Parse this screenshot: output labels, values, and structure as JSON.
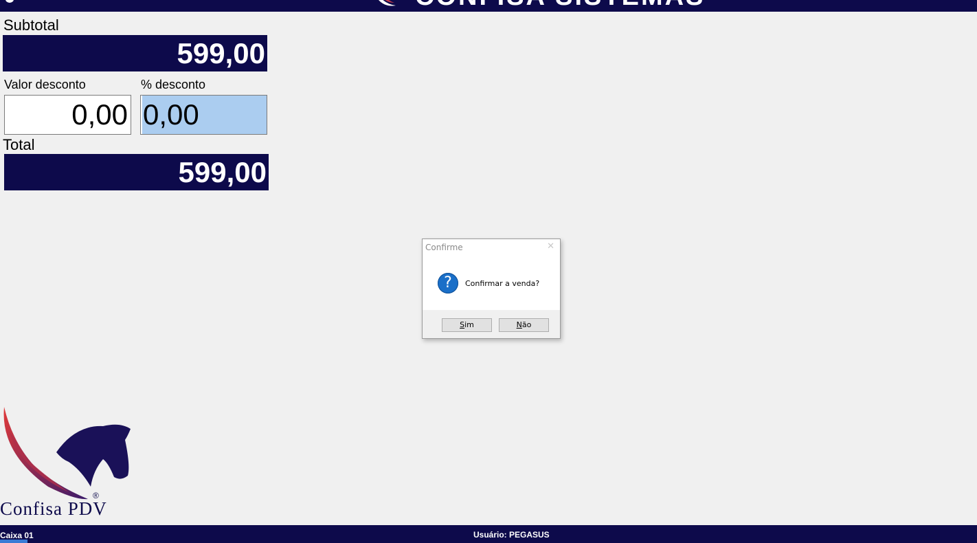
{
  "banner": {
    "text": "CONFISA SISTEMAS"
  },
  "summary": {
    "subtotal_label": "Subtotal",
    "subtotal_value": "599,00",
    "discount_value_label": "Valor desconto",
    "discount_value": "0,00",
    "discount_percent_label": "% desconto",
    "discount_percent": "0,00",
    "total_label": "Total",
    "total_value": "599,00"
  },
  "logo": {
    "text": "Confisa PDV",
    "registered": "®"
  },
  "dialog": {
    "title": "Confirme",
    "close_glyph": "✕",
    "icon": "question-icon",
    "icon_glyph": "?",
    "message": "Confirmar a venda?",
    "yes_hotkey": "S",
    "yes_rest": "im",
    "no_hotkey": "N",
    "no_rest": "ão"
  },
  "statusbar": {
    "register": "Caixa 01",
    "user": "Usuário: PEGASUS"
  },
  "colors": {
    "navy": "#0d0a4b",
    "selection": "#abcdf0",
    "dialog_icon": "#1a6fc8"
  }
}
